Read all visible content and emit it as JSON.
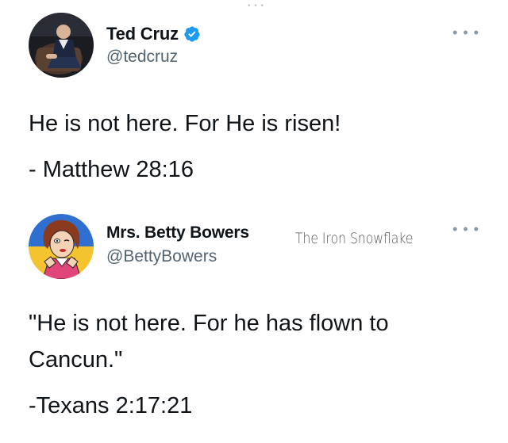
{
  "tweets": [
    {
      "author": {
        "name": "Ted Cruz",
        "handle": "@tedcruz",
        "verified": true,
        "avatar_icon": "person-in-chair-avatar"
      },
      "more_icon": "more-options-icon",
      "lines": [
        "He is not here. For He is risen!",
        "- Matthew 28:16"
      ]
    },
    {
      "author": {
        "name": "Mrs. Betty Bowers",
        "handle": "@BettyBowers",
        "verified": false,
        "avatar_icon": "cartoon-woman-avatar"
      },
      "more_icon": "more-options-icon",
      "watermark": "The Iron Snowflake",
      "lines": [
        "\"He is not here. For he has flown to",
        "Cancun.\"",
        "-Texans 2:17:21"
      ]
    }
  ],
  "colors": {
    "text_primary": "#0f1419",
    "text_secondary": "#536471",
    "verified_blue": "#1d9bf0",
    "avatar2_background_yellow": "#f4c430",
    "avatar2_background_blue": "#2f6fd0"
  }
}
